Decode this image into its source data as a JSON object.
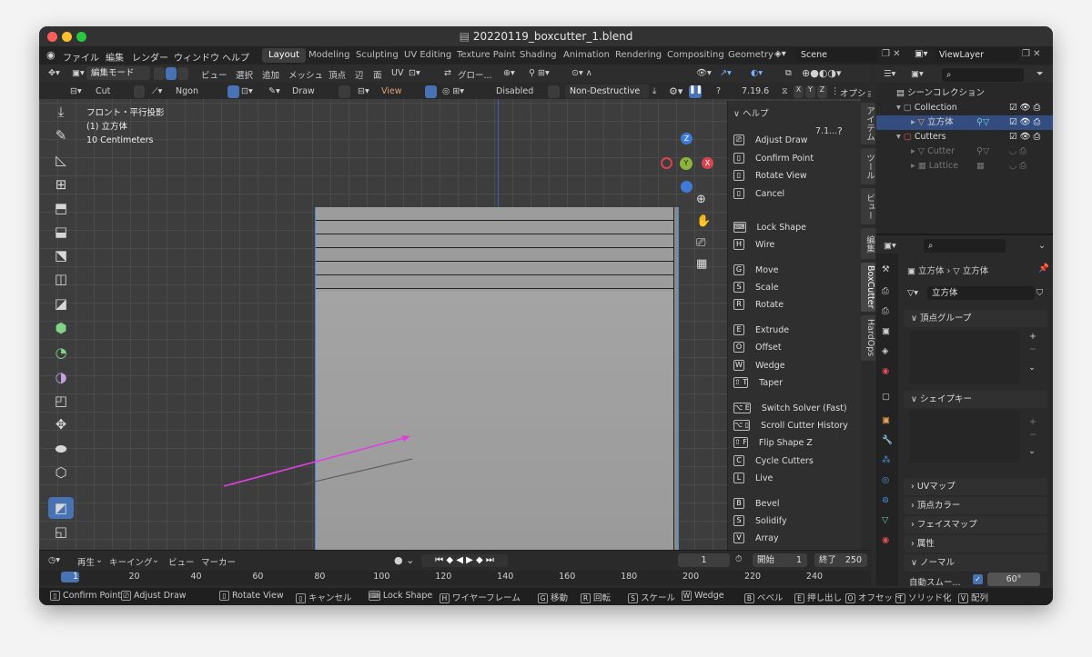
{
  "window": {
    "title": "20220119_boxcutter_1.blend"
  },
  "menu": [
    "ファイル",
    "編集",
    "レンダー",
    "ウィンドウ",
    "ヘルプ"
  ],
  "workspaces": [
    "Layout",
    "Modeling",
    "Sculpting",
    "UV Editing",
    "Texture Paint",
    "Shading",
    "Animation",
    "Rendering",
    "Compositing",
    "Geometry"
  ],
  "active_workspace": "Layout",
  "scene": "Scene",
  "view_layer": "ViewLayer",
  "header": {
    "mode": "編集モード",
    "menus": [
      "ビュー",
      "選択",
      "追加",
      "メッシュ",
      "頂点",
      "辺",
      "面",
      "UV"
    ],
    "orientation": "グロー..."
  },
  "tool_header": {
    "cut": "Cut",
    "shape": "Ngon",
    "draw": "Draw",
    "view": "View",
    "boolean": "Disabled",
    "mode": "Non-Destructive",
    "version": "7.19.6",
    "axes": [
      "X",
      "Y",
      "Z"
    ],
    "options": "オプション"
  },
  "overlay": {
    "view": "フロント・平行投影",
    "object": "(1) 立方体",
    "scale": "10 Centimeters"
  },
  "gizmo": {
    "x": "X",
    "y": "Y",
    "z": "Z"
  },
  "npanel": {
    "title": "ヘルプ",
    "version": "7.1...",
    "keys": [
      {
        "key": "⎚",
        "label": "Adjust Draw"
      },
      {
        "key": "▯",
        "label": "Confirm Point"
      },
      {
        "key": "▯",
        "label": "Rotate View"
      },
      {
        "key": "▯",
        "label": "Cancel"
      },
      {
        "key": "⌨",
        "label": "Lock Shape"
      },
      {
        "key": "H",
        "label": "Wire"
      },
      {
        "key": "G",
        "label": "Move"
      },
      {
        "key": "S",
        "label": "Scale"
      },
      {
        "key": "R",
        "label": "Rotate"
      },
      {
        "key": "E",
        "label": "Extrude"
      },
      {
        "key": "O",
        "label": "Offset"
      },
      {
        "key": "W",
        "label": "Wedge"
      },
      {
        "key": "⇧ T",
        "label": "Taper"
      },
      {
        "key": "⌥ E",
        "label": "Switch Solver (Fast)"
      },
      {
        "key": "⌥ ▯",
        "label": "Scroll Cutter History"
      },
      {
        "key": "⇧ F",
        "label": "Flip Shape Z"
      },
      {
        "key": "C",
        "label": "Cycle Cutters"
      },
      {
        "key": "L",
        "label": "Live"
      },
      {
        "key": "B",
        "label": "Bevel"
      },
      {
        "key": "S",
        "label": "Solidify"
      },
      {
        "key": "V",
        "label": "Array"
      }
    ],
    "tabs": [
      "アイテム",
      "ツール",
      "ビュー",
      "編集",
      "BoxCutter",
      "HardOps"
    ]
  },
  "outliner": {
    "root": "シーンコレクション",
    "rows": [
      {
        "label": "Collection"
      },
      {
        "label": "立方体"
      },
      {
        "label": "Cutters"
      },
      {
        "label": "Cutter"
      },
      {
        "label": "Lattice"
      }
    ]
  },
  "properties": {
    "object": "立方体",
    "data": "立方体",
    "mesh_name": "立方体",
    "sections": [
      "頂点グループ",
      "シェイプキー",
      "UVマップ",
      "頂点カラー",
      "フェイスマップ",
      "属性",
      "ノーマル"
    ],
    "autosmooth": "自動スムー...",
    "angle": "60°"
  },
  "timeline": {
    "menus": [
      "再生",
      "キーイング",
      "ビュー",
      "マーカー"
    ],
    "current": "1",
    "start_label": "開始",
    "start": "1",
    "end_label": "終了",
    "end": "250",
    "ticks": [
      "1",
      "20",
      "40",
      "60",
      "80",
      "100",
      "120",
      "140",
      "160",
      "180",
      "200",
      "220",
      "240"
    ]
  },
  "status": [
    {
      "key": "▯",
      "label": "Confirm Point"
    },
    {
      "key": "⎚",
      "label": "Adjust Draw"
    },
    {
      "key": "▯",
      "label": "Rotate View"
    },
    {
      "key": "▯",
      "label": "キャンセル"
    },
    {
      "key": "⌨",
      "label": "Lock Shape"
    },
    {
      "key": "H",
      "label": "ワイヤーフレーム"
    },
    {
      "key": "G",
      "label": "移動"
    },
    {
      "key": "R",
      "label": "回転"
    },
    {
      "key": "S",
      "label": "スケール"
    },
    {
      "key": "W",
      "label": "Wedge"
    },
    {
      "key": "B",
      "label": "ベベル"
    },
    {
      "key": "E",
      "label": "押し出し"
    },
    {
      "key": "O",
      "label": "オフセット"
    },
    {
      "key": "T",
      "label": "ソリッド化"
    },
    {
      "key": "V",
      "label": "配列"
    }
  ],
  "colors": {
    "accent": "#4772b3",
    "magenta": "#e040e0",
    "x_axis": "#d64550",
    "y_axis": "#8db33a",
    "z_axis": "#3e7bd6"
  }
}
